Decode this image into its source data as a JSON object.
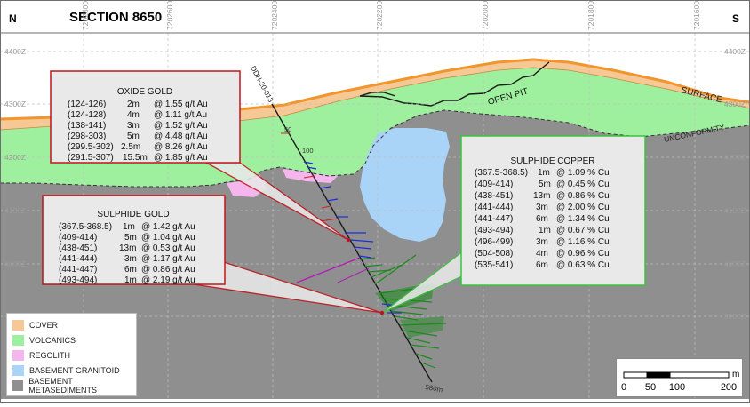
{
  "header": {
    "north": "N",
    "south": "S",
    "title": "SECTION 8650"
  },
  "northings": [
    "7202800Y",
    "7202600Y",
    "7202400Y",
    "7202200Y",
    "7202000Y",
    "7201800Y",
    "7201600Y"
  ],
  "elevations": [
    "4400Z",
    "4300Z",
    "4200Z",
    "4100Z",
    "4000Z",
    "3900Z"
  ],
  "labels": {
    "surface": "SURFACE",
    "unconformity": "UNCONFORMITY",
    "open_pit": "OPEN PIT",
    "drillhole": "DDH-20-013",
    "depth_50": "50",
    "depth_100": "100",
    "depth_580": "580m"
  },
  "callouts": {
    "oxide_gold": {
      "title": "OXIDE GOLD",
      "rows": [
        [
          "(124-126)",
          "2m",
          "@ 1.55 g/t Au"
        ],
        [
          "(124-128)",
          "4m",
          "@ 1.11 g/t Au"
        ],
        [
          "(138-141)",
          "3m",
          "@ 1.52 g/t Au"
        ],
        [
          "(298-303)",
          "5m",
          "@ 4.48 g/t Au"
        ],
        [
          "(299.5-302)",
          "2.5m",
          "@ 8.26 g/t Au"
        ],
        [
          "(291.5-307)",
          "15.5m",
          "@ 1.85 g/t Au"
        ]
      ]
    },
    "sulphide_gold": {
      "title": "SULPHIDE GOLD",
      "rows": [
        [
          "(367.5-368.5)",
          "1m",
          "@ 1.42 g/t Au"
        ],
        [
          "(409-414)",
          "5m",
          "@ 1.04 g/t Au"
        ],
        [
          "(438-451)",
          "13m",
          "@ 0.53 g/t Au"
        ],
        [
          "(441-444)",
          "3m",
          "@ 1.17 g/t Au"
        ],
        [
          "(441-447)",
          "6m",
          "@ 0.86 g/t Au"
        ],
        [
          "(493-494)",
          "1m",
          "@ 2.19 g/t Au"
        ]
      ]
    },
    "sulphide_copper": {
      "title": "SULPHIDE COPPER",
      "rows": [
        [
          "(367.5-368.5)",
          "1m",
          "@ 1.09 % Cu"
        ],
        [
          "(409-414)",
          "5m",
          "@ 0.45 % Cu"
        ],
        [
          "(438-451)",
          "13m",
          "@ 0.86 % Cu"
        ],
        [
          "(441-444)",
          "3m",
          "@ 2.00 % Cu"
        ],
        [
          "(441-447)",
          "6m",
          "@ 1.34 % Cu"
        ],
        [
          "(493-494)",
          "1m",
          "@ 0.67 % Cu"
        ],
        [
          "(496-499)",
          "3m",
          "@ 1.16 % Cu"
        ],
        [
          "(504-508)",
          "4m",
          "@ 0.96 % Cu"
        ],
        [
          "(535-541)",
          "6m",
          "@ 0.63 % Cu"
        ]
      ]
    }
  },
  "legend": {
    "items": [
      {
        "label": "COVER",
        "color": "#f5c896"
      },
      {
        "label": "VOLCANICS",
        "color": "#9ef09e"
      },
      {
        "label": "REGOLITH",
        "color": "#f4b6ec"
      },
      {
        "label": "BASEMENT GRANITOID",
        "color": "#a9d3f7"
      },
      {
        "label": "BASEMENT METASEDIMENTS",
        "color": "#8f8f8f"
      }
    ]
  },
  "scale": {
    "unit": "m",
    "ticks": [
      "0",
      "50",
      "100",
      "200"
    ]
  },
  "colors": {
    "basement": "#8f8f8f",
    "volcanics": "#9ef09e",
    "cover": "#f5c896",
    "granitoid": "#a9d3f7",
    "regolith": "#f4b6ec",
    "surface_line": "#f0962c",
    "gold_trace": "#1f2dd6",
    "copper_trace": "#1c8a1c",
    "callout_border_red": "#c0141c",
    "callout_border_green": "#3cc43c"
  }
}
